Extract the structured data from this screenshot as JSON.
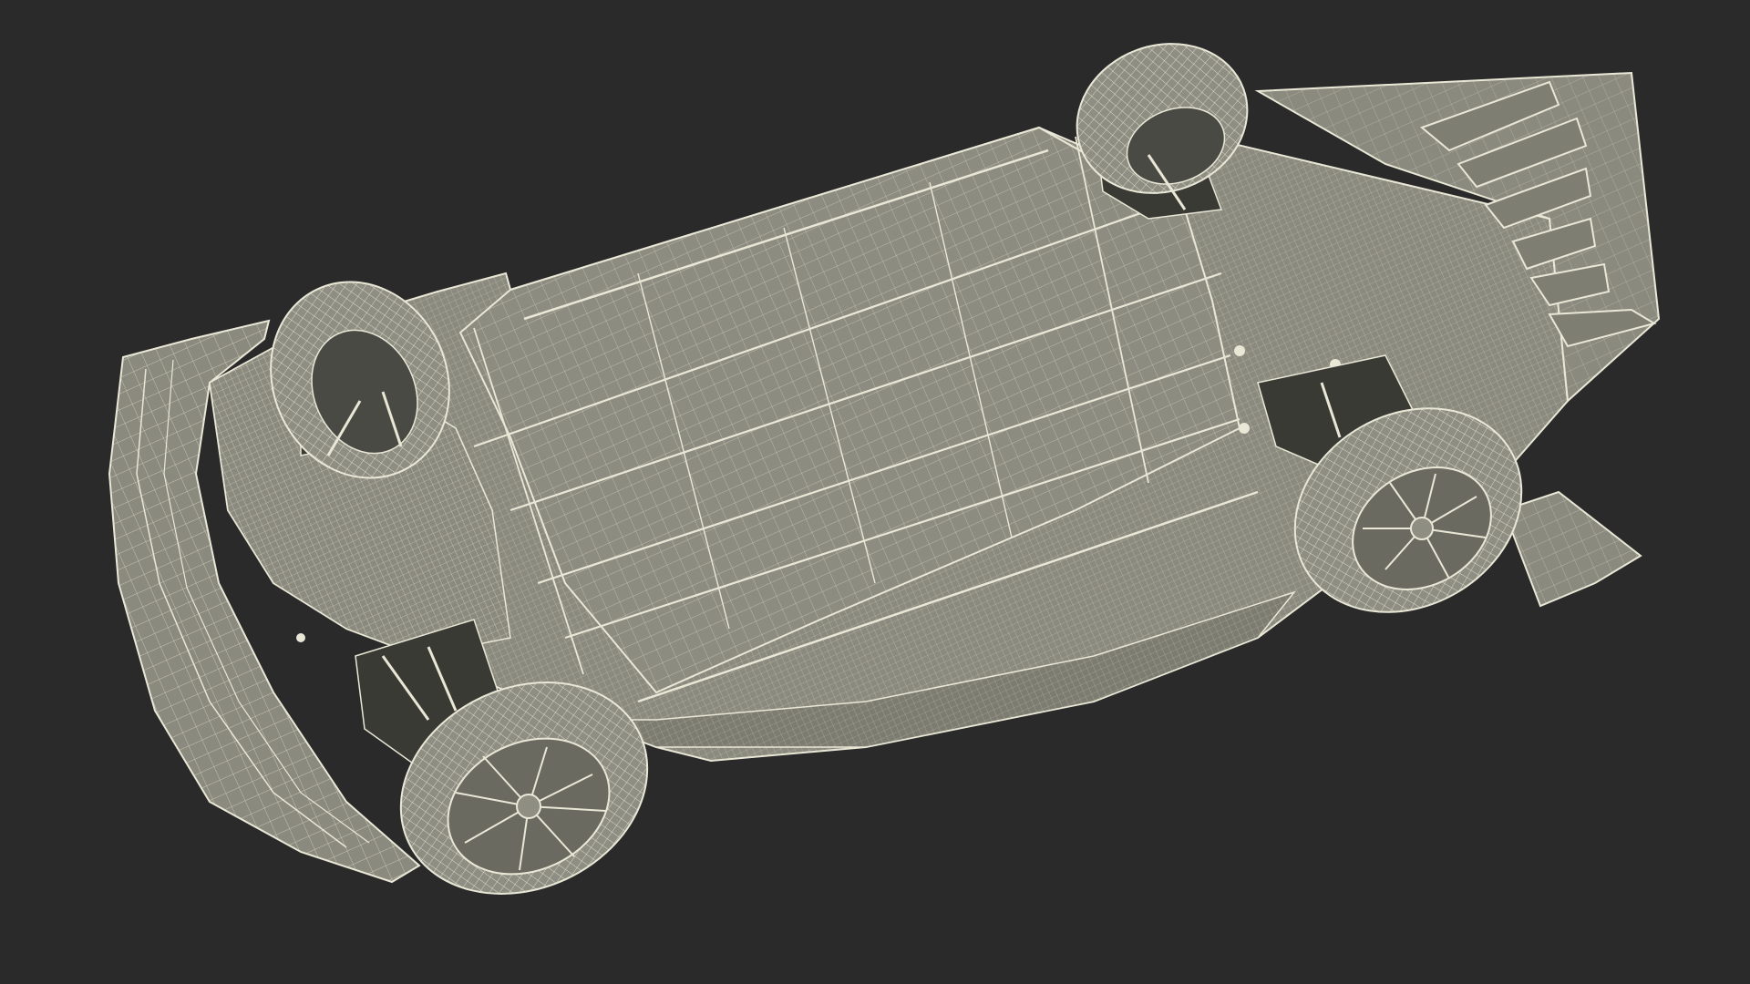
{
  "scene": {
    "background": "#2a2a2a",
    "model_fill": "#8a8a7e",
    "model_fill_dark": "#6e6e64",
    "wire_color": "#e9e7d6",
    "shadow_color": "#1f1f1f"
  }
}
